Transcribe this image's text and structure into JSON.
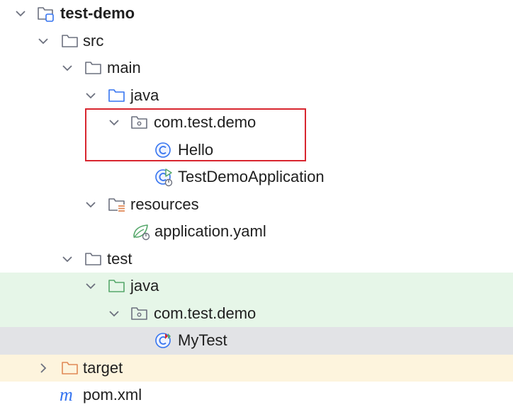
{
  "tree": {
    "rows": [
      {
        "label": "test-demo",
        "icon": "project-module-icon",
        "expanded": true,
        "bold": true
      },
      {
        "label": "src",
        "icon": "folder-icon",
        "expanded": true
      },
      {
        "label": "main",
        "icon": "folder-icon",
        "expanded": true
      },
      {
        "label": "java",
        "icon": "source-root-folder-icon",
        "expanded": true
      },
      {
        "label": "com.test.demo",
        "icon": "package-icon",
        "expanded": true
      },
      {
        "label": "Hello",
        "icon": "java-class-icon"
      },
      {
        "label": "TestDemoApplication",
        "icon": "spring-boot-class-icon"
      },
      {
        "label": "resources",
        "icon": "resources-folder-icon",
        "expanded": true
      },
      {
        "label": "application.yaml",
        "icon": "spring-config-icon"
      },
      {
        "label": "test",
        "icon": "folder-icon",
        "expanded": true
      },
      {
        "label": "java",
        "icon": "test-source-root-folder-icon",
        "expanded": true
      },
      {
        "label": "com.test.demo",
        "icon": "package-icon",
        "expanded": true
      },
      {
        "label": "MyTest",
        "icon": "test-class-icon",
        "selected": true
      },
      {
        "label": "target",
        "icon": "excluded-folder-icon",
        "expanded": false
      },
      {
        "label": "pom.xml",
        "icon": "maven-icon"
      }
    ]
  },
  "colors": {
    "test_source_bg": "#e6f6e8",
    "selected_bg": "#e2e3e6",
    "excluded_bg": "#fdf4dd",
    "highlight_border": "#d8262f",
    "folder_stroke": "#6c707e",
    "source_folder_stroke": "#3574f0",
    "test_folder_stroke": "#55a76a",
    "excluded_folder_stroke": "#e08855",
    "class_icon_stroke": "#3574f0"
  }
}
